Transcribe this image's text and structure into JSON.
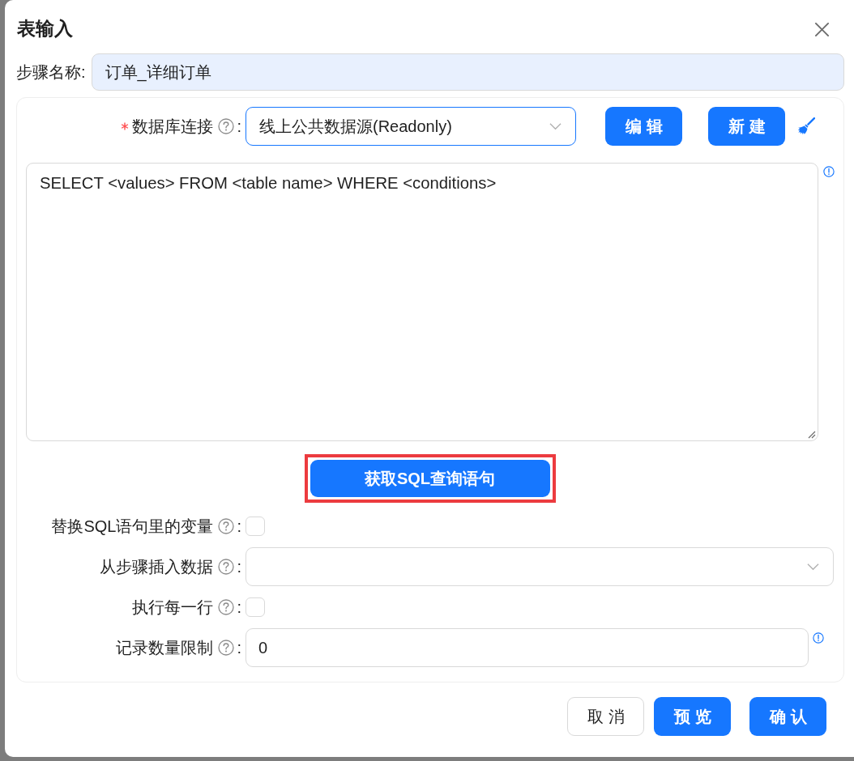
{
  "dialog": {
    "title": "表输入"
  },
  "step_name": {
    "label": "步骤名称:",
    "value": "订单_详细订单"
  },
  "connection": {
    "label": "数据库连接",
    "required": true,
    "colon": ":",
    "value": "线上公共数据源(Readonly)",
    "focused": true,
    "buttons": [
      "编辑",
      "新建"
    ]
  },
  "sql_editor": {
    "value": "SELECT <values> FROM <table name> WHERE <conditions>"
  },
  "get_sql_button": {
    "label": "获取SQL查询语句",
    "highlighted": true
  },
  "options": [
    {
      "kind": "checkbox",
      "label": "替换SQL语句里的变量",
      "colon": ":",
      "checked": false
    },
    {
      "kind": "select",
      "label": "从步骤插入数据",
      "colon": ":"
    },
    {
      "kind": "checkbox",
      "label": "执行每一行",
      "colon": ":",
      "checked": false
    },
    {
      "kind": "input",
      "label": "记录数量限制",
      "colon": ":",
      "value": "0"
    }
  ],
  "footer": {
    "buttons": [
      {
        "label": "取消",
        "primary": false
      },
      {
        "label": "预览",
        "primary": true
      },
      {
        "label": "确认",
        "primary": true
      }
    ]
  }
}
